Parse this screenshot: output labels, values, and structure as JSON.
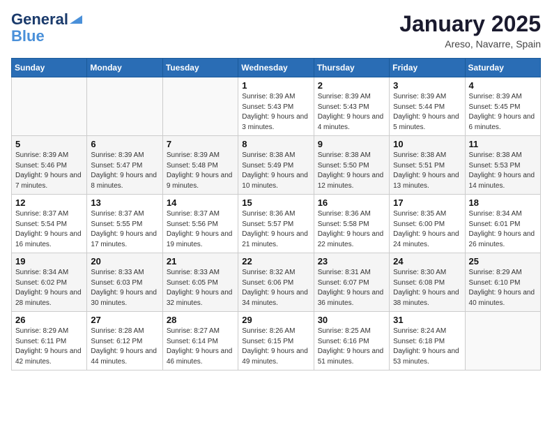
{
  "logo": {
    "line1": "General",
    "line2": "Blue"
  },
  "title": "January 2025",
  "location": "Areso, Navarre, Spain",
  "weekdays": [
    "Sunday",
    "Monday",
    "Tuesday",
    "Wednesday",
    "Thursday",
    "Friday",
    "Saturday"
  ],
  "weeks": [
    [
      {
        "day": "",
        "sunrise": "",
        "sunset": "",
        "daylight": ""
      },
      {
        "day": "",
        "sunrise": "",
        "sunset": "",
        "daylight": ""
      },
      {
        "day": "",
        "sunrise": "",
        "sunset": "",
        "daylight": ""
      },
      {
        "day": "1",
        "sunrise": "8:39 AM",
        "sunset": "5:43 PM",
        "daylight": "9 hours and 3 minutes."
      },
      {
        "day": "2",
        "sunrise": "8:39 AM",
        "sunset": "5:43 PM",
        "daylight": "9 hours and 4 minutes."
      },
      {
        "day": "3",
        "sunrise": "8:39 AM",
        "sunset": "5:44 PM",
        "daylight": "9 hours and 5 minutes."
      },
      {
        "day": "4",
        "sunrise": "8:39 AM",
        "sunset": "5:45 PM",
        "daylight": "9 hours and 6 minutes."
      }
    ],
    [
      {
        "day": "5",
        "sunrise": "8:39 AM",
        "sunset": "5:46 PM",
        "daylight": "9 hours and 7 minutes."
      },
      {
        "day": "6",
        "sunrise": "8:39 AM",
        "sunset": "5:47 PM",
        "daylight": "9 hours and 8 minutes."
      },
      {
        "day": "7",
        "sunrise": "8:39 AM",
        "sunset": "5:48 PM",
        "daylight": "9 hours and 9 minutes."
      },
      {
        "day": "8",
        "sunrise": "8:38 AM",
        "sunset": "5:49 PM",
        "daylight": "9 hours and 10 minutes."
      },
      {
        "day": "9",
        "sunrise": "8:38 AM",
        "sunset": "5:50 PM",
        "daylight": "9 hours and 12 minutes."
      },
      {
        "day": "10",
        "sunrise": "8:38 AM",
        "sunset": "5:51 PM",
        "daylight": "9 hours and 13 minutes."
      },
      {
        "day": "11",
        "sunrise": "8:38 AM",
        "sunset": "5:53 PM",
        "daylight": "9 hours and 14 minutes."
      }
    ],
    [
      {
        "day": "12",
        "sunrise": "8:37 AM",
        "sunset": "5:54 PM",
        "daylight": "9 hours and 16 minutes."
      },
      {
        "day": "13",
        "sunrise": "8:37 AM",
        "sunset": "5:55 PM",
        "daylight": "9 hours and 17 minutes."
      },
      {
        "day": "14",
        "sunrise": "8:37 AM",
        "sunset": "5:56 PM",
        "daylight": "9 hours and 19 minutes."
      },
      {
        "day": "15",
        "sunrise": "8:36 AM",
        "sunset": "5:57 PM",
        "daylight": "9 hours and 21 minutes."
      },
      {
        "day": "16",
        "sunrise": "8:36 AM",
        "sunset": "5:58 PM",
        "daylight": "9 hours and 22 minutes."
      },
      {
        "day": "17",
        "sunrise": "8:35 AM",
        "sunset": "6:00 PM",
        "daylight": "9 hours and 24 minutes."
      },
      {
        "day": "18",
        "sunrise": "8:34 AM",
        "sunset": "6:01 PM",
        "daylight": "9 hours and 26 minutes."
      }
    ],
    [
      {
        "day": "19",
        "sunrise": "8:34 AM",
        "sunset": "6:02 PM",
        "daylight": "9 hours and 28 minutes."
      },
      {
        "day": "20",
        "sunrise": "8:33 AM",
        "sunset": "6:03 PM",
        "daylight": "9 hours and 30 minutes."
      },
      {
        "day": "21",
        "sunrise": "8:33 AM",
        "sunset": "6:05 PM",
        "daylight": "9 hours and 32 minutes."
      },
      {
        "day": "22",
        "sunrise": "8:32 AM",
        "sunset": "6:06 PM",
        "daylight": "9 hours and 34 minutes."
      },
      {
        "day": "23",
        "sunrise": "8:31 AM",
        "sunset": "6:07 PM",
        "daylight": "9 hours and 36 minutes."
      },
      {
        "day": "24",
        "sunrise": "8:30 AM",
        "sunset": "6:08 PM",
        "daylight": "9 hours and 38 minutes."
      },
      {
        "day": "25",
        "sunrise": "8:29 AM",
        "sunset": "6:10 PM",
        "daylight": "9 hours and 40 minutes."
      }
    ],
    [
      {
        "day": "26",
        "sunrise": "8:29 AM",
        "sunset": "6:11 PM",
        "daylight": "9 hours and 42 minutes."
      },
      {
        "day": "27",
        "sunrise": "8:28 AM",
        "sunset": "6:12 PM",
        "daylight": "9 hours and 44 minutes."
      },
      {
        "day": "28",
        "sunrise": "8:27 AM",
        "sunset": "6:14 PM",
        "daylight": "9 hours and 46 minutes."
      },
      {
        "day": "29",
        "sunrise": "8:26 AM",
        "sunset": "6:15 PM",
        "daylight": "9 hours and 49 minutes."
      },
      {
        "day": "30",
        "sunrise": "8:25 AM",
        "sunset": "6:16 PM",
        "daylight": "9 hours and 51 minutes."
      },
      {
        "day": "31",
        "sunrise": "8:24 AM",
        "sunset": "6:18 PM",
        "daylight": "9 hours and 53 minutes."
      },
      {
        "day": "",
        "sunrise": "",
        "sunset": "",
        "daylight": ""
      }
    ]
  ]
}
